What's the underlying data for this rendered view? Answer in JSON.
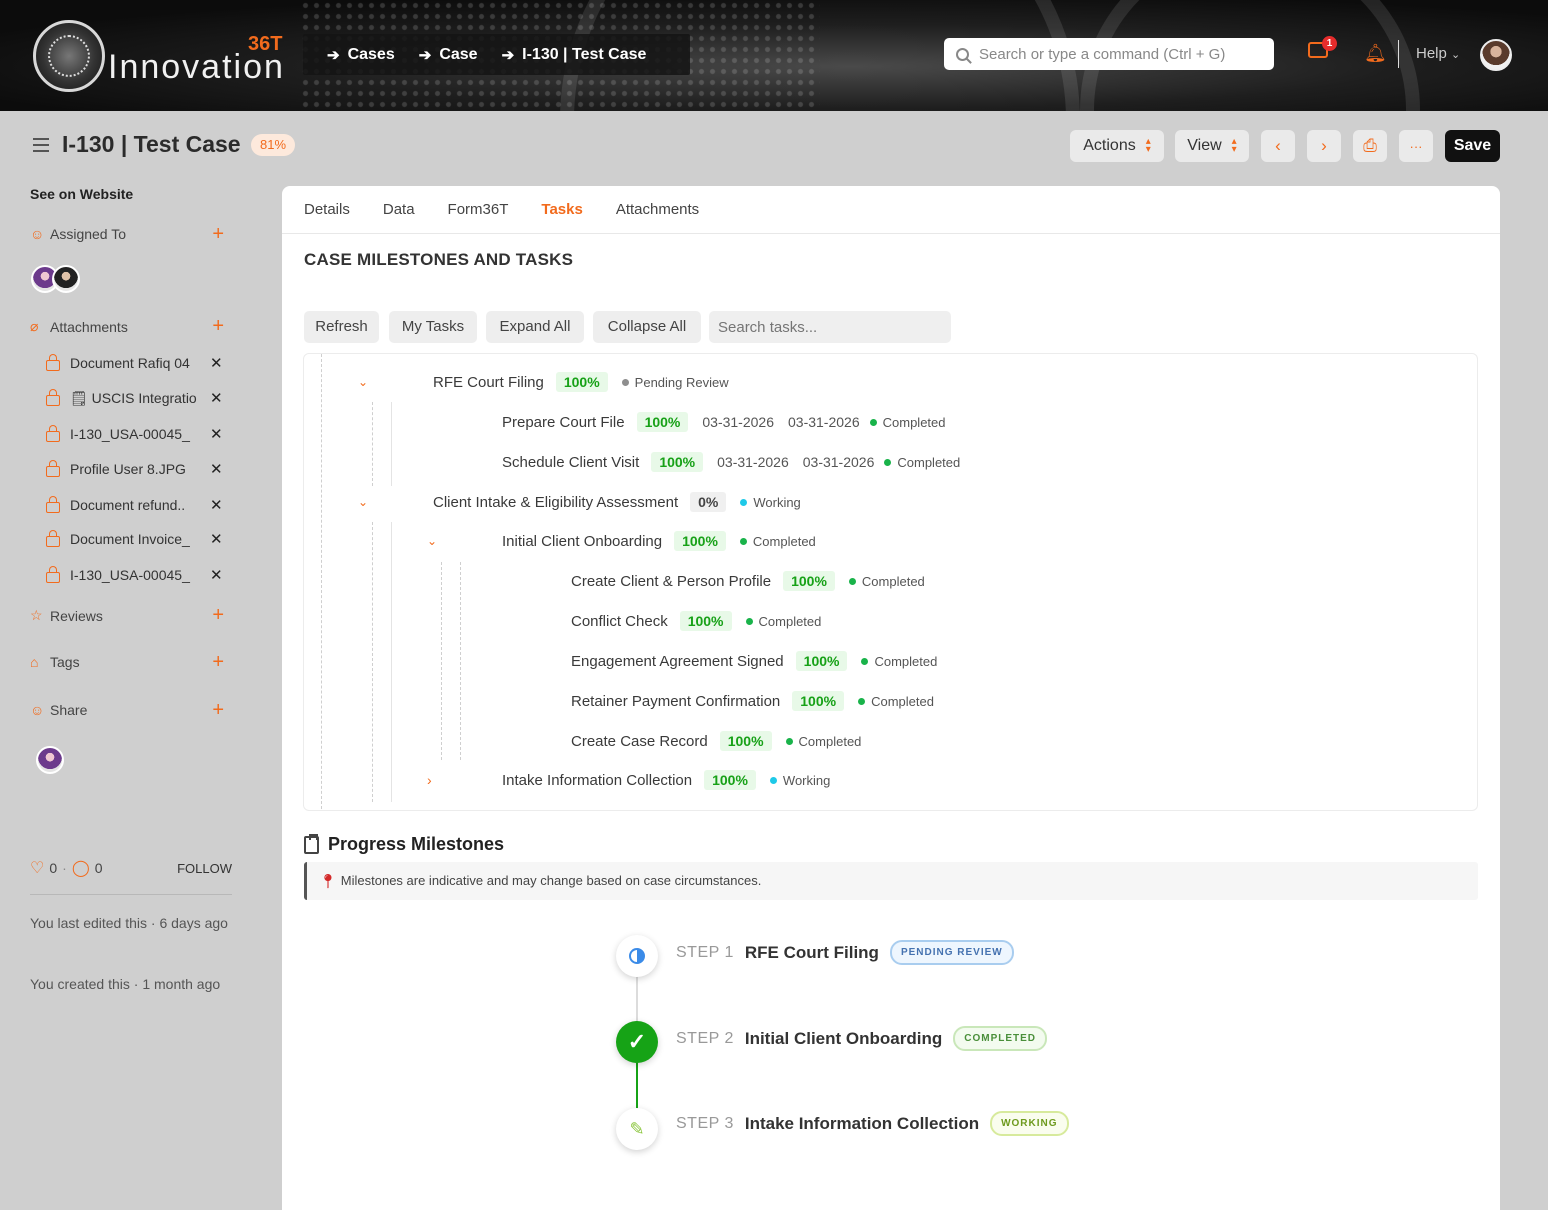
{
  "topbar": {
    "logo_text": "Innovation",
    "logo_suffix": "36T",
    "breadcrumbs": [
      "Cases",
      "Case",
      "I-130 | Test Case"
    ],
    "search_placeholder": "Search or type a command (Ctrl + G)",
    "notification_count": "1",
    "help_label": "Help"
  },
  "header": {
    "title": "I-130 | Test Case",
    "progress_pill": "81%",
    "actions_label": "Actions",
    "view_label": "View",
    "more_label": "···",
    "save_label": "Save"
  },
  "sidebar": {
    "see_on_website": "See on Website",
    "assigned_to": "Assigned To",
    "attachments_label": "Attachments",
    "attachments": [
      "Document Rafiq 04",
      "USCIS Integratio",
      "I-130_USA-00045_",
      "Profile User 8.JPG",
      "Document refund..",
      "Document Invoice_",
      "I-130_USA-00045_"
    ],
    "reviews": "Reviews",
    "tags": "Tags",
    "share": "Share",
    "likes": "0",
    "comments": "0",
    "follow": "FOLLOW",
    "last_edited": "You last edited this · 6 days ago",
    "created": "You created this · 1 month ago"
  },
  "tabs": [
    "Details",
    "Data",
    "Form36T",
    "Tasks",
    "Attachments"
  ],
  "active_tab": "Tasks",
  "tasks_section": {
    "title": "CASE MILESTONES AND TASKS",
    "buttons": [
      "Refresh",
      "My Tasks",
      "Expand All",
      "Collapse All"
    ],
    "search_placeholder": "Search tasks...",
    "rows": [
      {
        "name": "RFE Court Filing",
        "pct": "100%",
        "status": "Pending Review",
        "status_color": "#8e8e8e"
      },
      {
        "name": "Prepare Court File",
        "pct": "100%",
        "start": "03-31-2026",
        "end": "03-31-2026",
        "status": "Completed",
        "status_color": "#19b34a"
      },
      {
        "name": "Schedule Client Visit",
        "pct": "100%",
        "start": "03-31-2026",
        "end": "03-31-2026",
        "status": "Completed",
        "status_color": "#19b34a"
      },
      {
        "name": "Client Intake & Eligibility Assessment",
        "pct": "0%",
        "status": "Working",
        "status_color": "#1ec9e8"
      },
      {
        "name": "Initial Client Onboarding",
        "pct": "100%",
        "status": "Completed",
        "status_color": "#19b34a"
      },
      {
        "name": "Create Client & Person Profile",
        "pct": "100%",
        "status": "Completed",
        "status_color": "#19b34a"
      },
      {
        "name": "Conflict Check",
        "pct": "100%",
        "status": "Completed",
        "status_color": "#19b34a"
      },
      {
        "name": "Engagement Agreement Signed",
        "pct": "100%",
        "status": "Completed",
        "status_color": "#19b34a"
      },
      {
        "name": "Retainer Payment Confirmation",
        "pct": "100%",
        "status": "Completed",
        "status_color": "#19b34a"
      },
      {
        "name": "Create Case Record",
        "pct": "100%",
        "status": "Completed",
        "status_color": "#19b34a"
      },
      {
        "name": "Intake Information Collection",
        "pct": "100%",
        "status": "Working",
        "status_color": "#1ec9e8"
      }
    ]
  },
  "progress_milestones": {
    "title": "Progress Milestones",
    "note": "Milestones are indicative and may change based on case circumstances.",
    "steps": [
      {
        "num": "STEP 1",
        "title": "RFE Court Filing",
        "pill": "PENDING REVIEW",
        "icon": "half-circle-icon"
      },
      {
        "num": "STEP 2",
        "title": "Initial Client Onboarding",
        "pill": "COMPLETED",
        "icon": "check-icon"
      },
      {
        "num": "STEP 3",
        "title": "Intake Information Collection",
        "pill": "WORKING",
        "icon": "pencil-icon"
      }
    ]
  },
  "colors": {
    "accent": "#f26b1d",
    "completed": "#19b34a",
    "working": "#1ec9e8",
    "save_button": "#111111"
  }
}
